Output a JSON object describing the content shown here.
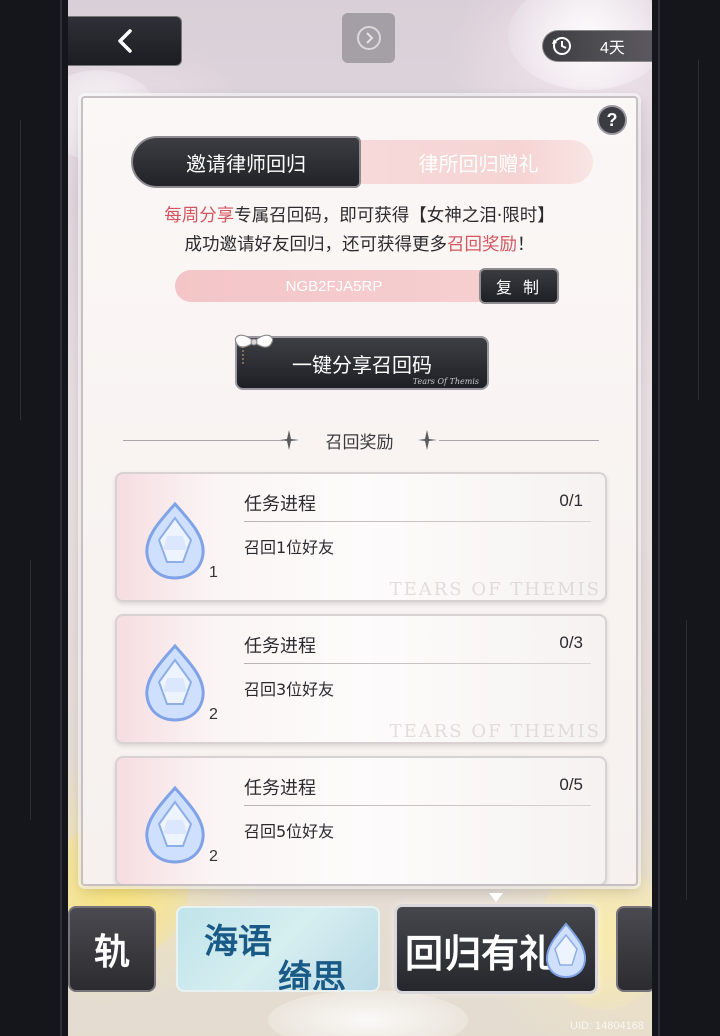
{
  "header": {
    "timer_value": "4天"
  },
  "panel": {
    "tabs": [
      {
        "label": "邀请律师回归",
        "active": true
      },
      {
        "label": "律所回归赠礼",
        "active": false
      }
    ],
    "description": {
      "line1_highlight": "每周分享",
      "line1_text": "专属召回码，即可获得【女神之泪·限时】",
      "line2_text": "成功邀请好友回归，还可获得更多",
      "line2_highlight": "召回奖励",
      "line2_end": "！"
    },
    "invite_code": "NGB2FJA5RP",
    "copy_label": "复 制",
    "share_label": "一键分享召回码",
    "share_script": "Tears Of Themis",
    "rewards_title": "召回奖励",
    "tasks": [
      {
        "title": "任务进程",
        "progress": "0/1",
        "desc": "召回1位好友",
        "reward_count": "1"
      },
      {
        "title": "任务进程",
        "progress": "0/3",
        "desc": "召回3位好友",
        "reward_count": "2"
      },
      {
        "title": "任务进程",
        "progress": "0/5",
        "desc": "召回5位好友",
        "reward_count": "2"
      }
    ],
    "watermark": "TEARS OF THEMIS"
  },
  "events": {
    "tab1_label": "轨",
    "tab2_line1": "海语",
    "tab2_line2": "绮思",
    "tab3_label": "回归有礼"
  },
  "footer": {
    "uid": "UID: 14804168"
  },
  "colors": {
    "accent_red": "#d55660",
    "tab_inactive": "#f5d4d3",
    "dark_button": "#26272c"
  }
}
